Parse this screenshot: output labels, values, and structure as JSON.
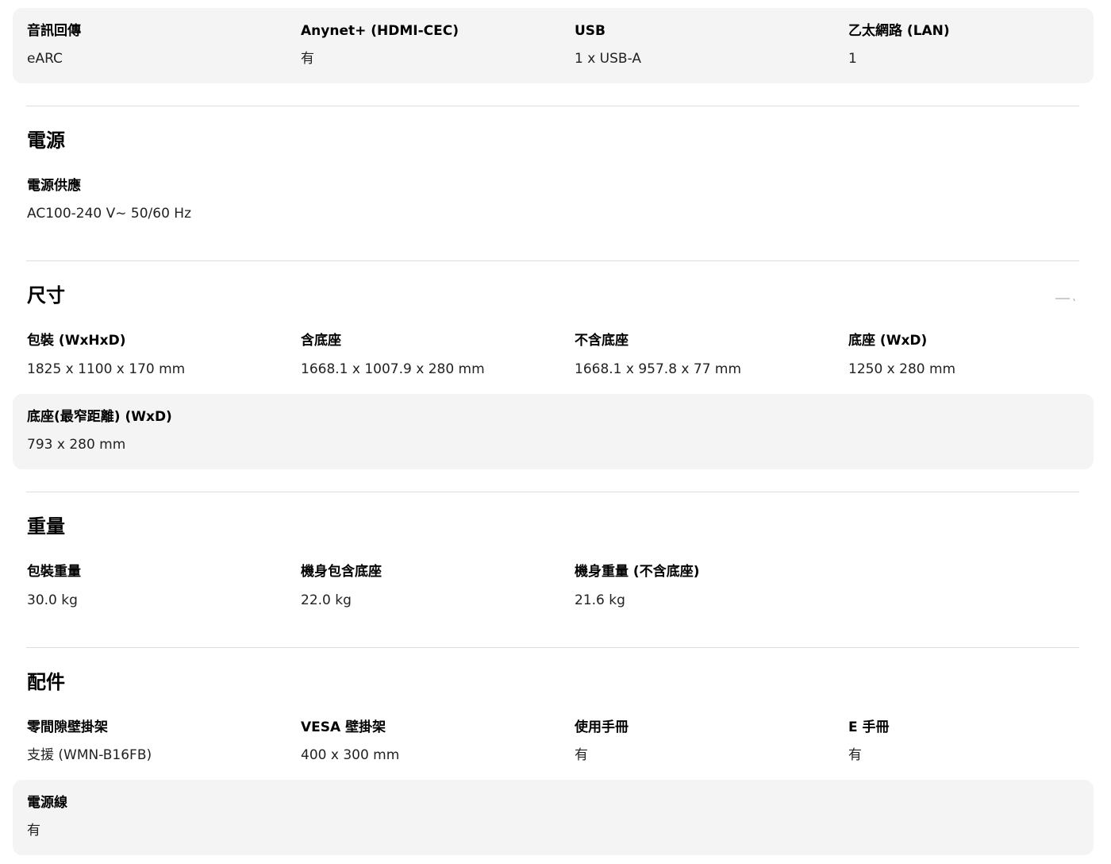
{
  "connectivity": {
    "items": [
      {
        "label": "音訊回傳",
        "value": "eARC"
      },
      {
        "label": "Anynet+ (HDMI-CEC)",
        "value": "有"
      },
      {
        "label": "USB",
        "value": "1 x USB-A"
      },
      {
        "label": "乙太網路 (LAN)",
        "value": "1"
      }
    ]
  },
  "power": {
    "title": "電源",
    "items": [
      {
        "label": "電源供應",
        "value": "AC100-240 V~ 50/60 Hz"
      }
    ]
  },
  "dimensions": {
    "title": "尺寸",
    "toggle_icon": "minus-icon",
    "items": [
      {
        "label": "包裝 (WxHxD)",
        "value": "1825 x 1100 x 170 mm"
      },
      {
        "label": "含底座",
        "value": "1668.1 x 1007.9 x 280 mm"
      },
      {
        "label": "不含底座",
        "value": "1668.1 x 957.8 x 77 mm"
      },
      {
        "label": "底座 (WxD)",
        "value": "1250 x 280 mm"
      },
      {
        "label": "底座(最窄距離) (WxD)",
        "value": "793 x 280 mm"
      }
    ]
  },
  "weight": {
    "title": "重量",
    "items": [
      {
        "label": "包裝重量",
        "value": "30.0 kg"
      },
      {
        "label": "機身包含底座",
        "value": "22.0 kg"
      },
      {
        "label": "機身重量 (不含底座)",
        "value": "21.6 kg"
      }
    ]
  },
  "accessories": {
    "title": "配件",
    "items": [
      {
        "label": "零間隙壁掛架",
        "value": "支援 (WMN-B16FB)"
      },
      {
        "label": "VESA 壁掛架",
        "value": "400 x 300 mm"
      },
      {
        "label": "使用手冊",
        "value": "有"
      },
      {
        "label": "E 手冊",
        "value": "有"
      },
      {
        "label": "電源線",
        "value": "有"
      }
    ]
  },
  "colors": {
    "panel_background": "#f4f4f4",
    "divider": "#dddddd",
    "text": "#000000"
  }
}
